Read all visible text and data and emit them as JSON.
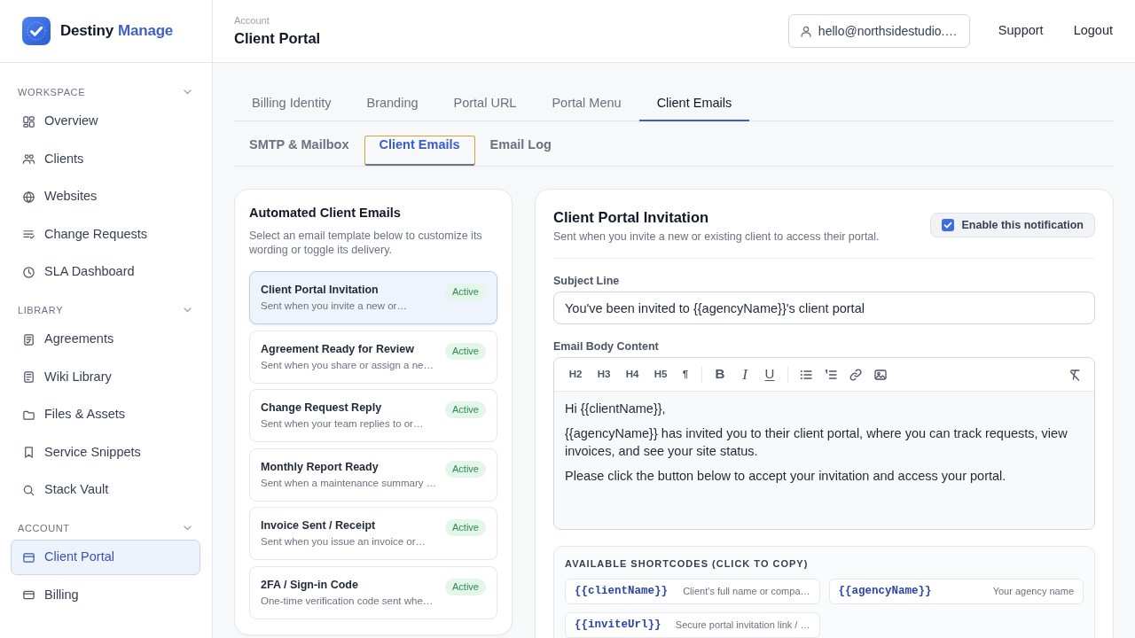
{
  "brand": {
    "name": "Destiny",
    "suffix": "Manage"
  },
  "sidebar": {
    "sections": [
      {
        "title": "WORKSPACE",
        "expanded": true,
        "items": [
          {
            "label": "Overview",
            "selected": false
          },
          {
            "label": "Clients",
            "selected": false
          },
          {
            "label": "Websites",
            "selected": false
          },
          {
            "label": "Change Requests",
            "selected": false
          },
          {
            "label": "SLA Dashboard",
            "selected": false
          }
        ]
      },
      {
        "title": "LIBRARY",
        "expanded": true,
        "items": [
          {
            "label": "Agreements",
            "selected": false
          },
          {
            "label": "Wiki Library",
            "selected": false
          },
          {
            "label": "Files & Assets",
            "selected": false
          },
          {
            "label": "Service Snippets",
            "selected": false
          },
          {
            "label": "Stack Vault",
            "selected": false
          }
        ]
      },
      {
        "title": "ACCOUNT",
        "expanded": true,
        "items": [
          {
            "label": "Client Portal",
            "selected": true
          },
          {
            "label": "Billing",
            "selected": false
          }
        ]
      }
    ]
  },
  "header": {
    "breadcrumb": "Account",
    "title": "Client Portal",
    "account": "hello@northsidestudio.…",
    "links": [
      "Support",
      "Logout"
    ]
  },
  "tabs": [
    {
      "label": "Billing Identity",
      "selected": false
    },
    {
      "label": "Branding",
      "selected": false
    },
    {
      "label": "Portal URL",
      "selected": false
    },
    {
      "label": "Portal Menu",
      "selected": false
    },
    {
      "label": "Client Emails",
      "selected": true
    }
  ],
  "subtabs": [
    {
      "label": "SMTP & Mailbox",
      "selected": false
    },
    {
      "label": "Client Emails",
      "selected": true
    },
    {
      "label": "Email Log",
      "selected": false
    }
  ],
  "templates": {
    "title": "Automated Client Emails",
    "description": "Select an email template below to customize its wording or toggle its delivery.",
    "items": [
      {
        "title": "Client Portal Invitation",
        "summary": "Sent when you invite a new or…",
        "status": "Active",
        "selected": true
      },
      {
        "title": "Agreement Ready for Review",
        "summary": "Sent when you share or assign a ne…",
        "status": "Active",
        "selected": false
      },
      {
        "title": "Change Request Reply",
        "summary": "Sent when your team replies to or…",
        "status": "Active",
        "selected": false
      },
      {
        "title": "Monthly Report Ready",
        "summary": "Sent when a maintenance summary …",
        "status": "Active",
        "selected": false
      },
      {
        "title": "Invoice Sent / Receipt",
        "summary": "Sent when you issue an invoice or…",
        "status": "Active",
        "selected": false
      },
      {
        "title": "2FA / Sign-in Code",
        "summary": "One-time verification code sent whe…",
        "status": "Active",
        "selected": false
      }
    ]
  },
  "editor": {
    "title": "Client Portal Invitation",
    "description": "Sent when you invite a new or existing client to access their portal.",
    "enable": {
      "label": "Enable this notification",
      "checked": true
    },
    "subject": {
      "label": "Subject Line",
      "value": "You've been invited to {{agencyName}}'s client portal"
    },
    "body": {
      "label": "Email Body Content",
      "blocks": [
        {
          "label": "H2"
        },
        {
          "label": "H3"
        },
        {
          "label": "H4"
        },
        {
          "label": "H5"
        },
        {
          "label": "¶"
        }
      ],
      "marks": [
        {
          "label": "B",
          "kind": "bold"
        },
        {
          "label": "I",
          "kind": "italic"
        },
        {
          "label": "U",
          "kind": "underline"
        }
      ],
      "paragraphs": [
        "Hi {{clientName}},",
        "{{agencyName}} has invited you to their client portal, where you can track requests, view invoices, and see your site status.",
        "Please click the button below to accept your invitation and access your portal."
      ]
    },
    "shortcodes": {
      "title": "AVAILABLE SHORTCODES (CLICK TO COPY)",
      "items": [
        {
          "code": "{{clientName}}",
          "description": "Client's full name or compa…"
        },
        {
          "code": "{{agencyName}}",
          "description": "Your agency name"
        },
        {
          "code": "{{inviteUrl}}",
          "description": "Secure portal invitation link / …"
        }
      ]
    }
  }
}
